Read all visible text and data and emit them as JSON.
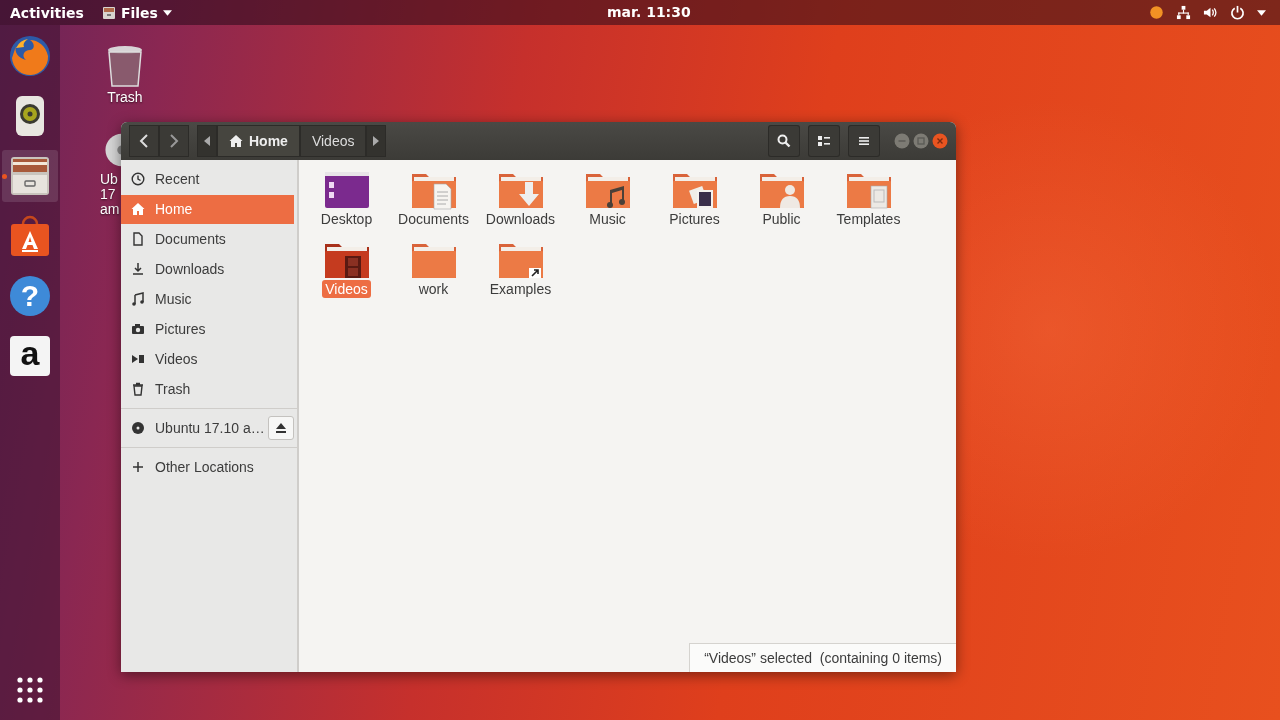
{
  "top_bar": {
    "activities": "Activities",
    "app_menu": "Files",
    "clock": "mar. 11:30"
  },
  "dock": [
    {
      "kind": "firefox",
      "running": false
    },
    {
      "kind": "speaker",
      "running": false
    },
    {
      "kind": "files",
      "running": true
    },
    {
      "kind": "store",
      "running": false
    },
    {
      "kind": "help",
      "running": false,
      "glyph": "?"
    },
    {
      "kind": "amazon",
      "running": false,
      "glyph": "a"
    }
  ],
  "desktop_icons": [
    {
      "kind": "trash",
      "label_lines": [
        "Trash"
      ]
    },
    {
      "kind": "disc",
      "label_lines": [
        "Ub",
        "17",
        "am"
      ]
    }
  ],
  "window": {
    "path": [
      {
        "label": "Home",
        "selected": true
      },
      {
        "label": "Videos",
        "selected": false
      }
    ],
    "sidebar": {
      "places": [
        {
          "label": "Recent",
          "kind": "recent",
          "selected": false
        },
        {
          "label": "Home",
          "kind": "home",
          "selected": true
        },
        {
          "label": "Documents",
          "kind": "documents",
          "selected": false
        },
        {
          "label": "Downloads",
          "kind": "downloads",
          "selected": false
        },
        {
          "label": "Music",
          "kind": "music",
          "selected": false
        },
        {
          "label": "Pictures",
          "kind": "pictures",
          "selected": false
        },
        {
          "label": "Videos",
          "kind": "videos",
          "selected": false
        },
        {
          "label": "Trash",
          "kind": "trash",
          "selected": false
        }
      ],
      "devices": [
        {
          "label": "Ubuntu 17.10 a…",
          "kind": "disc",
          "selected": false
        }
      ],
      "other": [
        {
          "label": "Other Locations",
          "kind": "plus",
          "selected": false
        }
      ]
    },
    "files": [
      {
        "name": "Desktop",
        "kind": "desktop",
        "selected": false
      },
      {
        "name": "Documents",
        "kind": "documents",
        "selected": false
      },
      {
        "name": "Downloads",
        "kind": "downloads",
        "selected": false
      },
      {
        "name": "Music",
        "kind": "music",
        "selected": false
      },
      {
        "name": "Pictures",
        "kind": "pictures",
        "selected": false
      },
      {
        "name": "Public",
        "kind": "public",
        "selected": false
      },
      {
        "name": "Templates",
        "kind": "templates",
        "selected": false
      },
      {
        "name": "Videos",
        "kind": "videos",
        "selected": true
      },
      {
        "name": "work",
        "kind": "plain",
        "selected": false
      },
      {
        "name": "Examples",
        "kind": "link",
        "selected": false
      }
    ],
    "status": "“Videos” selected  (containing 0 items)"
  }
}
